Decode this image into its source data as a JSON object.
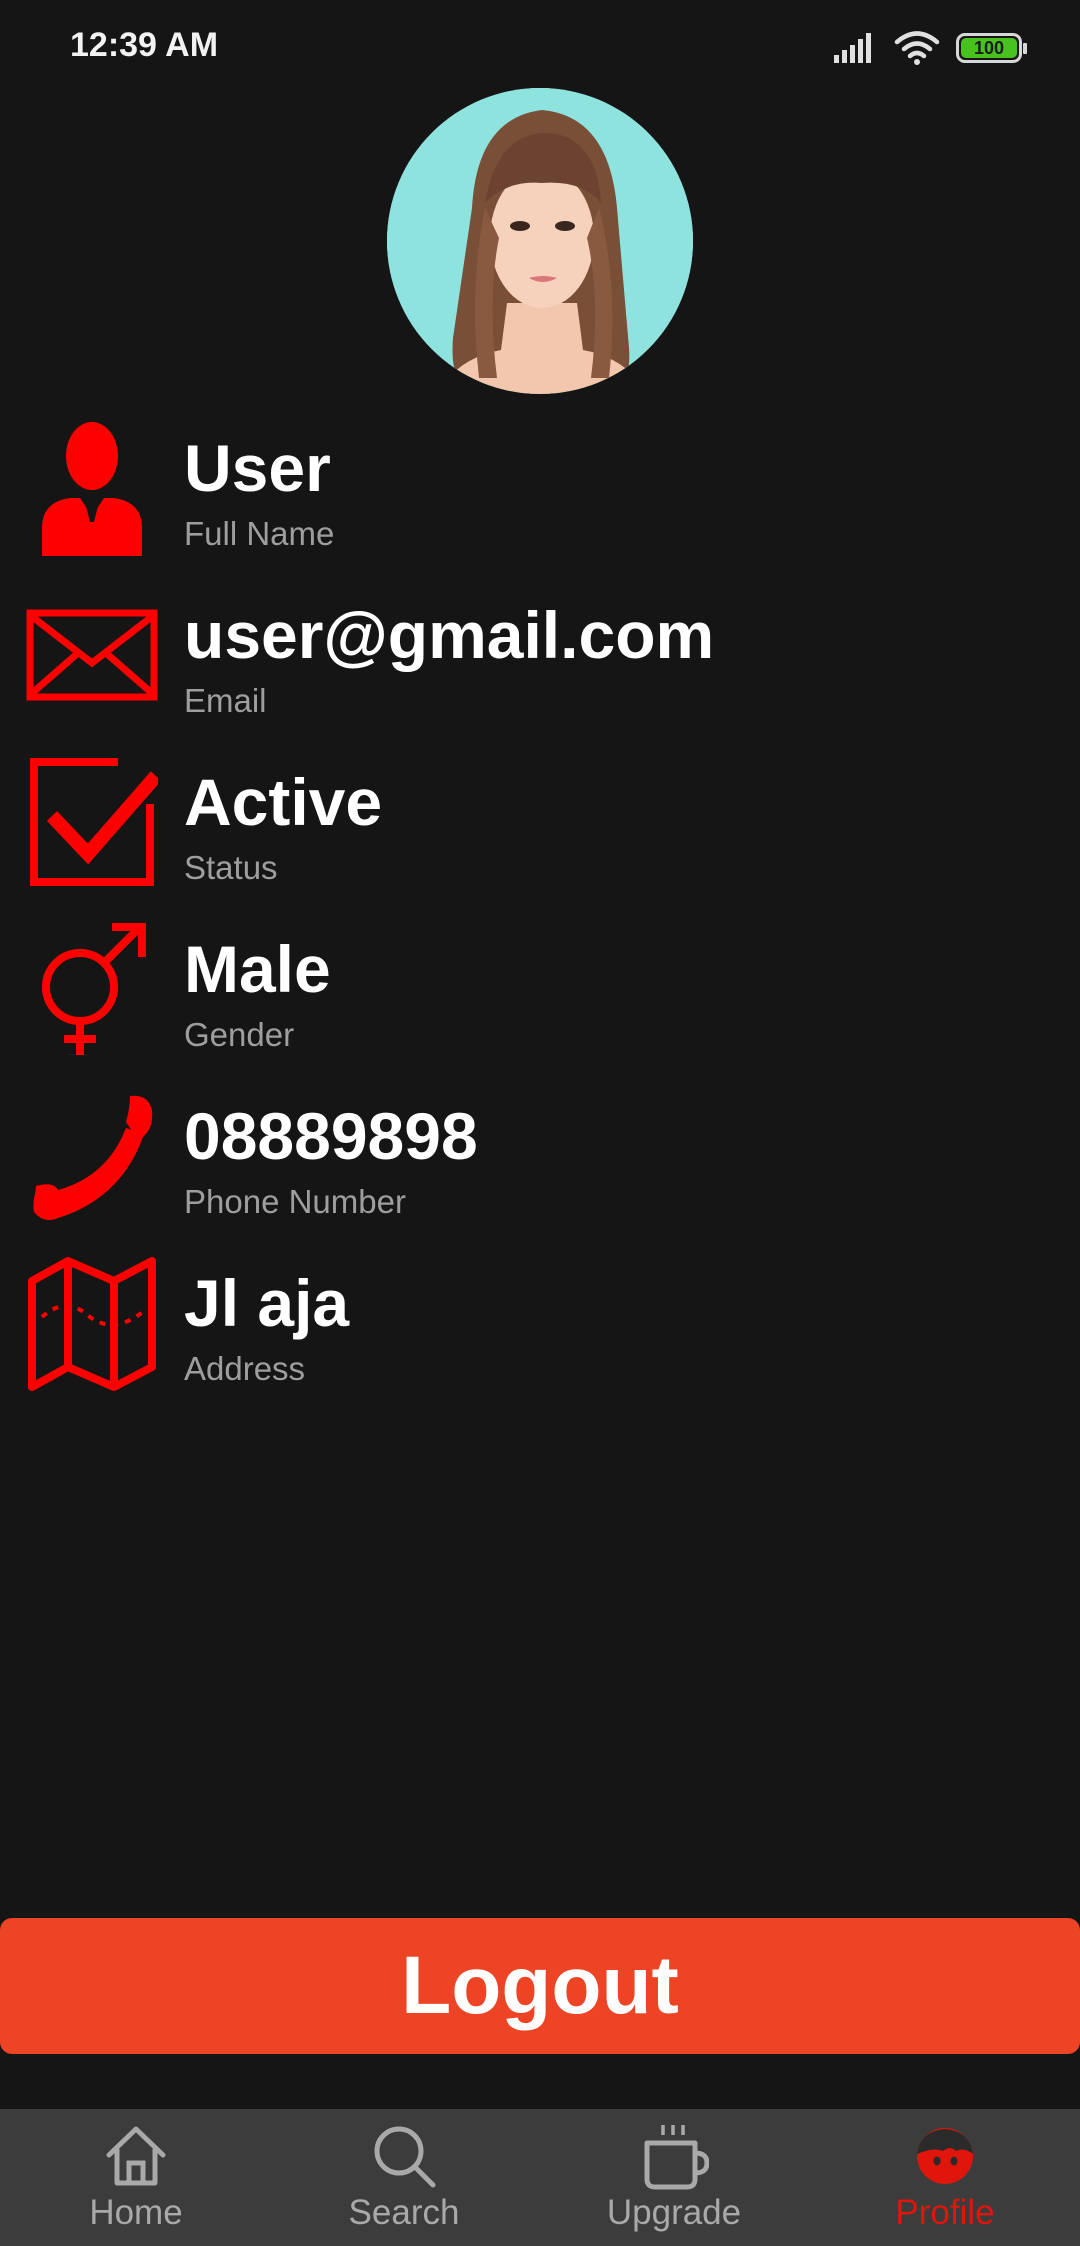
{
  "status_bar": {
    "time": "12:39 AM",
    "battery": "100",
    "icons": [
      "signal-icon",
      "wifi-icon",
      "battery-icon"
    ]
  },
  "profile": {
    "avatar": "profile-photo"
  },
  "info": [
    {
      "icon": "user-icon",
      "value": "User",
      "label": "Full Name"
    },
    {
      "icon": "email-icon",
      "value": "user@gmail.com",
      "label": "Email"
    },
    {
      "icon": "checkbox-icon",
      "value": "Active",
      "label": "Status"
    },
    {
      "icon": "gender-icon",
      "value": "Male",
      "label": "Gender"
    },
    {
      "icon": "phone-icon",
      "value": "08889898",
      "label": "Phone Number"
    },
    {
      "icon": "map-icon",
      "value": "Jl aja",
      "label": "Address"
    }
  ],
  "logout": {
    "label": "Logout"
  },
  "nav": {
    "items": [
      {
        "label": "Home",
        "icon": "home-icon"
      },
      {
        "label": "Search",
        "icon": "search-icon"
      },
      {
        "label": "Upgrade",
        "icon": "coffee-cup-icon"
      },
      {
        "label": "Profile",
        "icon": "profile-icon"
      }
    ],
    "active": "Profile"
  },
  "colors": {
    "background": "#151515",
    "accent_red": "#ff0000",
    "logout_button": "#ec4424",
    "nav_background": "#3c3c3c",
    "nav_active": "#e0150b",
    "nav_inactive": "#a9a9a9",
    "label_gray": "#9e9e9e"
  }
}
